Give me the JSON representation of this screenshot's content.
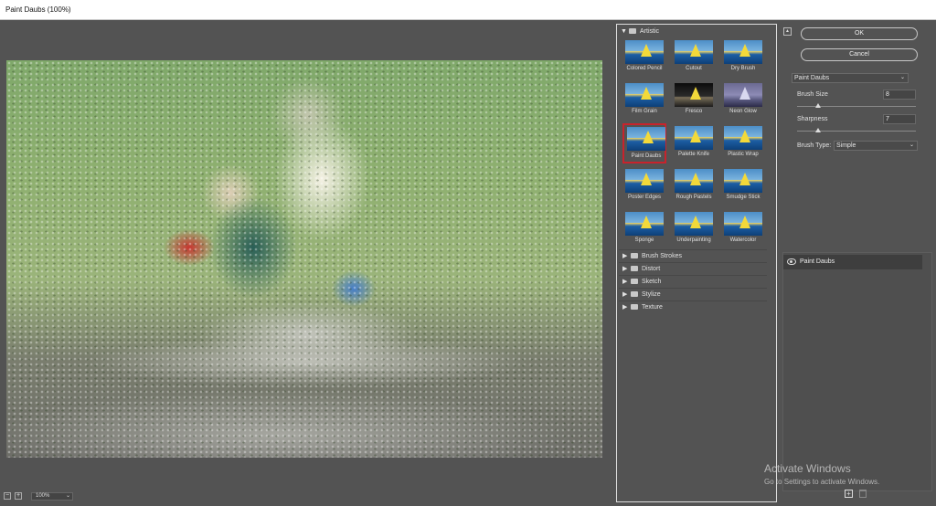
{
  "window": {
    "title": "Paint Daubs (100%)"
  },
  "preview": {
    "zoom": "100%",
    "zoom_out": "−",
    "zoom_in": "+"
  },
  "gallery": {
    "open_category": "Artistic",
    "thumbnails": [
      "Colored Pencil",
      "Cutout",
      "Dry Brush",
      "Film Grain",
      "Fresco",
      "Neon Glow",
      "Paint Daubs",
      "Palette Knife",
      "Plastic Wrap",
      "Poster Edges",
      "Rough Pastels",
      "Smudge Stick",
      "Sponge",
      "Underpainting",
      "Watercolor"
    ],
    "selected": "Paint Daubs",
    "categories": [
      "Brush Strokes",
      "Distort",
      "Sketch",
      "Stylize",
      "Texture"
    ]
  },
  "buttons": {
    "ok": "OK",
    "cancel": "Cancel"
  },
  "settings": {
    "filter": "Paint Daubs",
    "brush_size_label": "Brush Size",
    "brush_size": "8",
    "brush_size_level": 0.18,
    "sharpness_label": "Sharpness",
    "sharpness": "7",
    "sharpness_level": 0.18,
    "brush_type_label": "Brush Type:",
    "brush_type": "Simple"
  },
  "layers": {
    "items": [
      "Paint Daubs"
    ]
  },
  "watermark": {
    "line1": "Activate Windows",
    "line2": "Go to Settings to activate Windows."
  }
}
